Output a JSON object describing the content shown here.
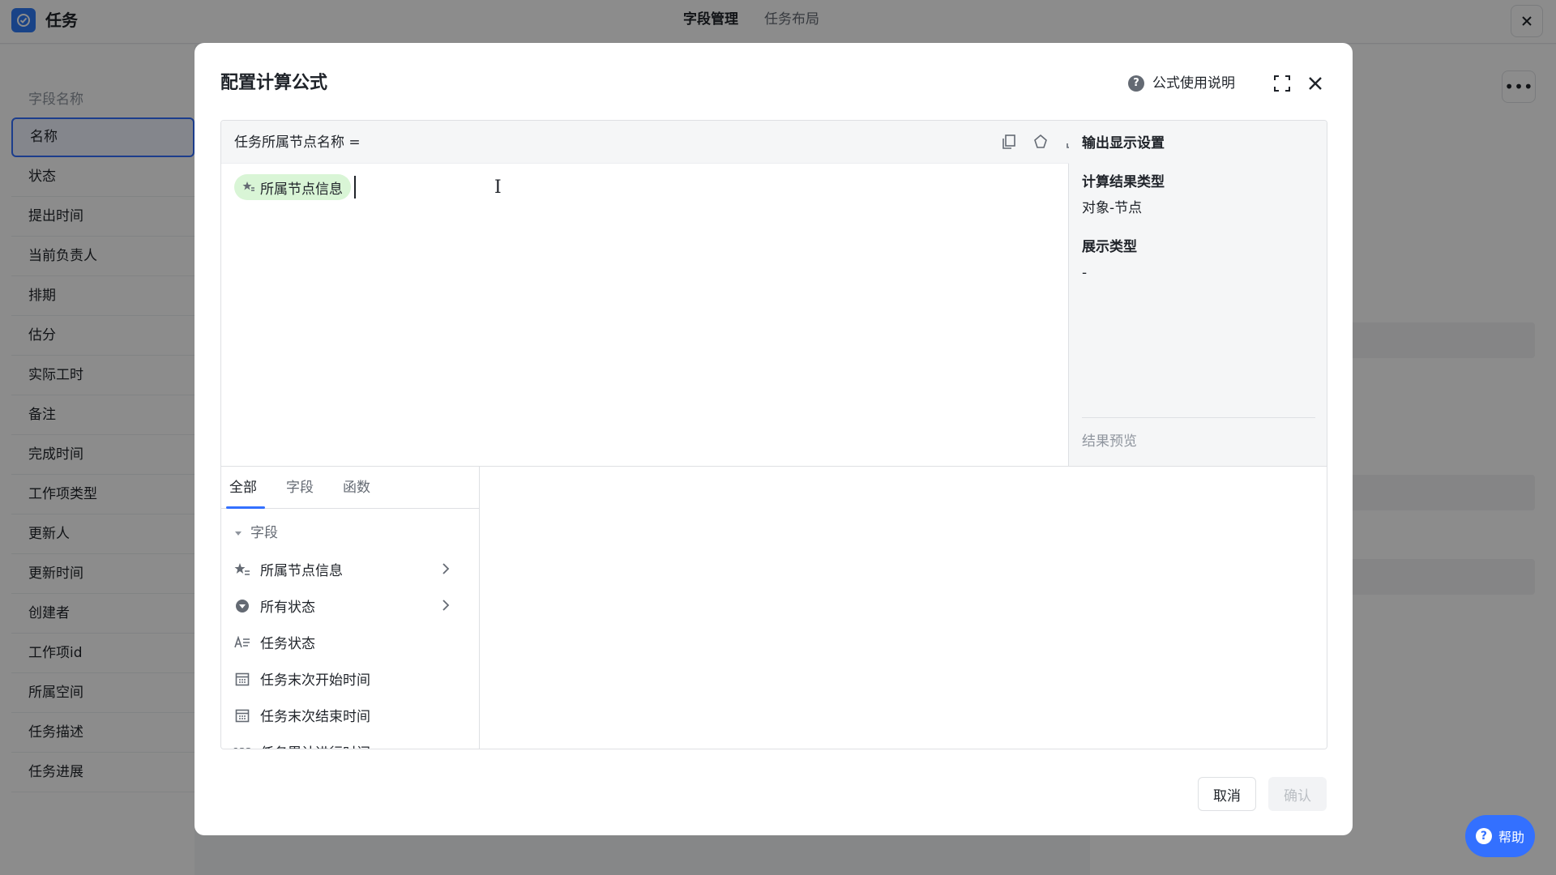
{
  "app": {
    "title": "任务",
    "tabs": [
      "字段管理",
      "任务布局"
    ],
    "close_icon": "close-icon"
  },
  "left_panel": {
    "header": "字段名称",
    "items": [
      "名称",
      "状态",
      "提出时间",
      "当前负责人",
      "排期",
      "估分",
      "实际工时",
      "备注",
      "完成时间",
      "工作项类型",
      "更新人",
      "更新时间",
      "创建者",
      "工作项id",
      "所属空间",
      "任务描述",
      "任务进展"
    ],
    "selected_index": 0
  },
  "right_panel": {
    "more_label": "•••"
  },
  "help_fab": {
    "label": "帮助"
  },
  "modal": {
    "title": "配置计算公式",
    "help_link": "公式使用说明",
    "formula_label": "任务所属节点名称 =",
    "token": "所属节点信息",
    "output": {
      "title": "输出显示设置",
      "result_type_label": "计算结果类型",
      "result_type_value": "对象-节点",
      "display_type_label": "展示类型",
      "display_type_value": "-",
      "preview_label": "结果预览"
    },
    "picker": {
      "tabs": [
        "全部",
        "字段",
        "函数"
      ],
      "active_tab": 0,
      "group_title": "字段",
      "items": [
        {
          "label": "所属节点信息",
          "icon": "node-star-icon",
          "has_children": true
        },
        {
          "label": "所有状态",
          "icon": "status-dropdown-icon",
          "has_children": true
        },
        {
          "label": "任务状态",
          "icon": "text-field-icon",
          "has_children": false
        },
        {
          "label": "任务末次开始时间",
          "icon": "calendar-icon",
          "has_children": false
        },
        {
          "label": "任务末次结束时间",
          "icon": "calendar-icon",
          "has_children": false
        },
        {
          "label": "任务累计进行时间",
          "icon": "number-icon",
          "has_children": false
        }
      ]
    },
    "buttons": {
      "cancel": "取消",
      "confirm": "确认"
    }
  },
  "colors": {
    "accent": "#3370ff",
    "token_bg": "#d9f5d6",
    "overlay": "rgba(0,0,0,0.45)"
  }
}
